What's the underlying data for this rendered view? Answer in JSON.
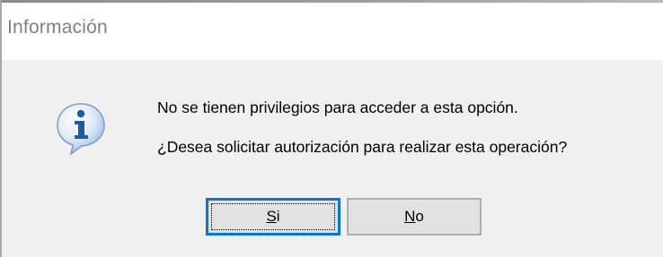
{
  "window": {
    "title": "Información"
  },
  "icon": {
    "name": "info-icon",
    "glyph": "i",
    "color": "#2a5db0"
  },
  "message": {
    "line1": "No se tienen privilegios para acceder a esta opción.",
    "line2": "¿Desea solicitar autorización para realizar esta operación?"
  },
  "buttons": {
    "yes": {
      "mnemonic": "S",
      "rest": "i",
      "label": "Si"
    },
    "no": {
      "mnemonic": "N",
      "rest": "o",
      "label": "No"
    }
  },
  "colors": {
    "default_button_border": "#0078d7"
  }
}
